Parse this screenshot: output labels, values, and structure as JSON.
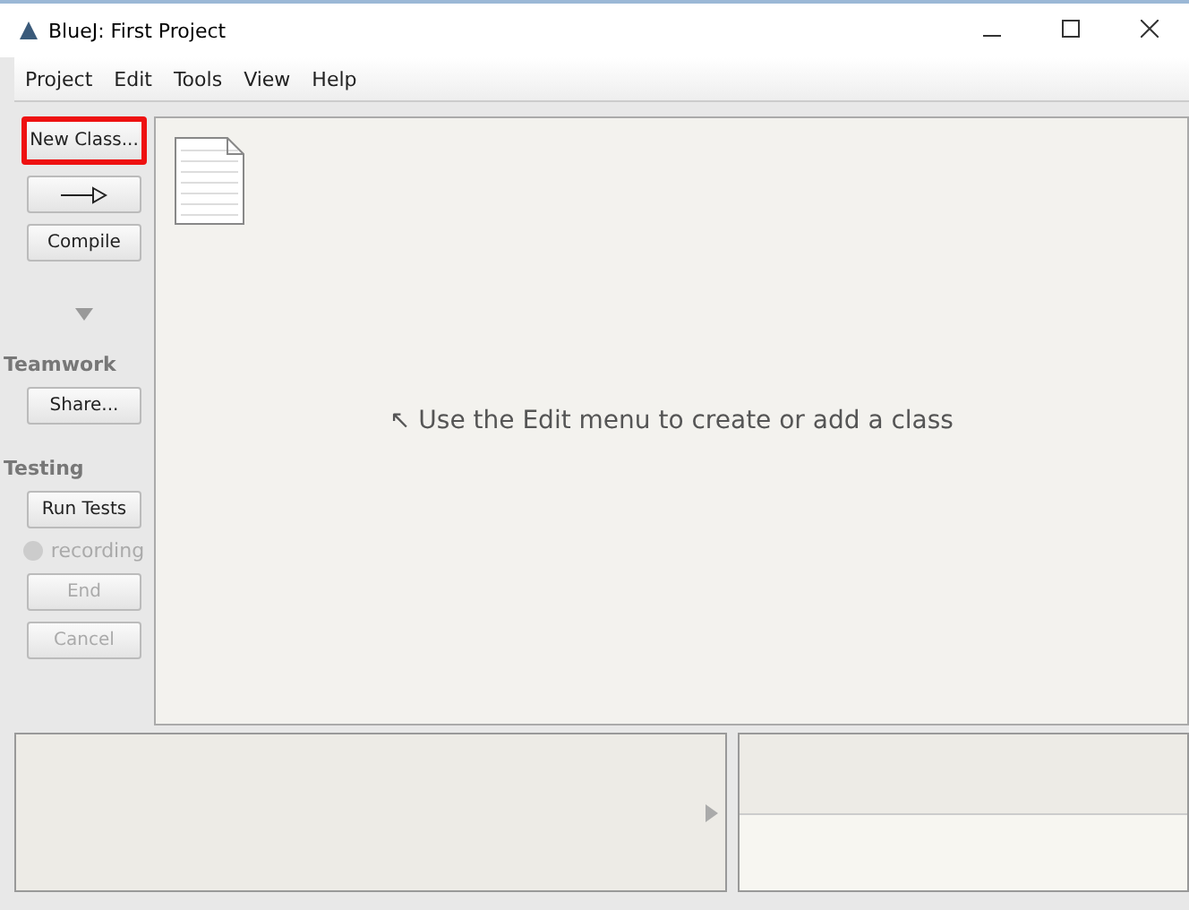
{
  "window": {
    "title": "BlueJ:  First Project"
  },
  "menu": [
    "Project",
    "Edit",
    "Tools",
    "View",
    "Help"
  ],
  "sidebar": {
    "buttons": [
      {
        "kind": "text",
        "label": "New Class...",
        "highlighted": true
      },
      {
        "kind": "arrow",
        "highlighted": false
      },
      {
        "kind": "text",
        "label": "Compile",
        "highlighted": false
      }
    ],
    "sections": [
      {
        "title": "Teamwork",
        "items": [
          {
            "kind": "button",
            "label": "Share...",
            "disabled": false
          }
        ]
      },
      {
        "title": "Testing",
        "items": [
          {
            "kind": "button",
            "label": "Run Tests",
            "disabled": false
          },
          {
            "kind": "indicator",
            "label": "recording",
            "disabled": true
          },
          {
            "kind": "button",
            "label": "End",
            "disabled": true
          },
          {
            "kind": "button",
            "label": "Cancel",
            "disabled": true
          }
        ]
      }
    ]
  },
  "canvas": {
    "hint": "↖ Use the Edit menu to create or add a class"
  }
}
